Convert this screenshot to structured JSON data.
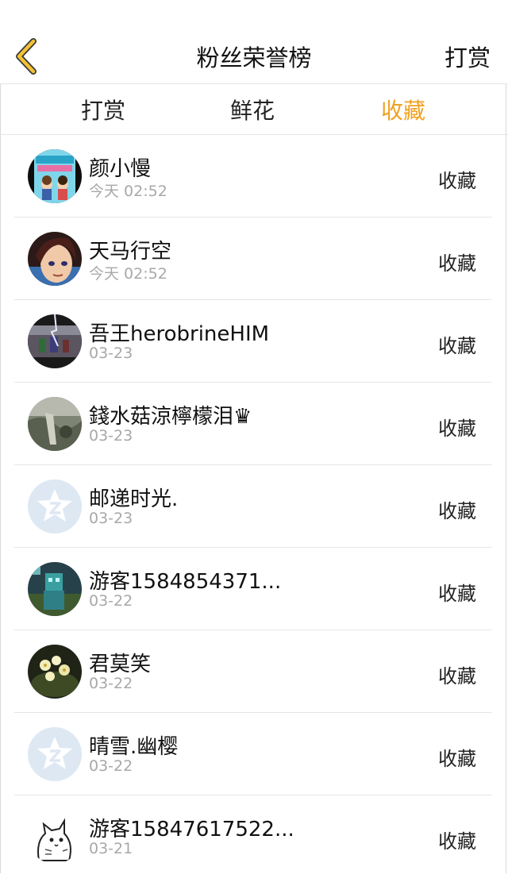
{
  "header": {
    "title": "粉丝荣誉榜",
    "action_label": "打赏"
  },
  "tabs": [
    {
      "label": "打赏",
      "active": false
    },
    {
      "label": "鲜花",
      "active": false
    },
    {
      "label": "收藏",
      "active": true
    }
  ],
  "colors": {
    "accent": "#f0a121",
    "back_icon": "#f3c234"
  },
  "fans": [
    {
      "name": "颜小慢",
      "time": "今天 02:52",
      "type": "收藏",
      "avatar": "cartoon-cover-avatar"
    },
    {
      "name": "天马行空",
      "time": "今天 02:52",
      "type": "收藏",
      "avatar": "anime-boy-avatar"
    },
    {
      "name": "吾王herobrineHIM",
      "time": "03-23",
      "type": "收藏",
      "avatar": "game-scene-avatar"
    },
    {
      "name": "錢水菇涼檸檬泪♛",
      "time": "03-23",
      "type": "收藏",
      "avatar": "photo-avatar"
    },
    {
      "name": "邮递时光.",
      "time": "03-23",
      "type": "收藏",
      "avatar": "default-avatar"
    },
    {
      "name": "游客1584854371...",
      "time": "03-22",
      "type": "收藏",
      "avatar": "game-character-avatar"
    },
    {
      "name": "君莫笑",
      "time": "03-22",
      "type": "收藏",
      "avatar": "flower-avatar"
    },
    {
      "name": "晴雪.幽樱",
      "time": "03-22",
      "type": "收藏",
      "avatar": "default-avatar"
    },
    {
      "name": "游客15847617522...",
      "time": "03-21",
      "type": "收藏",
      "avatar": "cat-sticker-avatar"
    }
  ]
}
